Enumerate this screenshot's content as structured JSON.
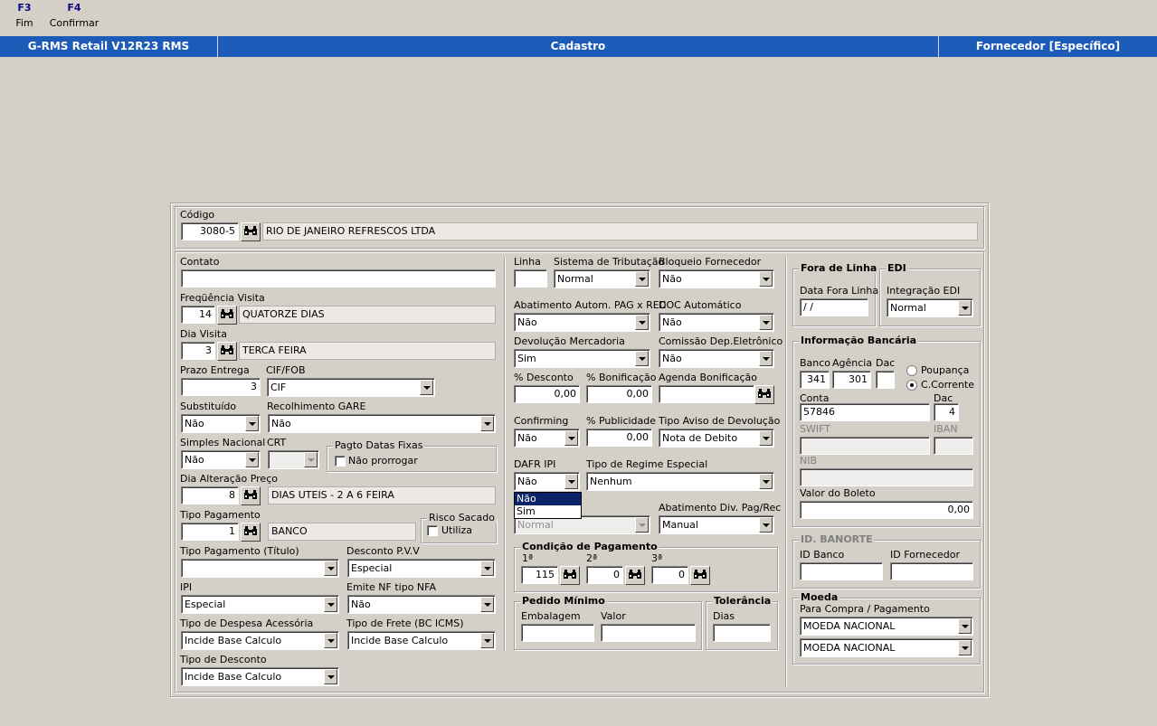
{
  "fkeys": [
    {
      "key": "F3",
      "label": "Fim"
    },
    {
      "key": "F4",
      "label": "Confirmar"
    }
  ],
  "titlebar": {
    "app": "G-RMS Retail V12R23 RMS",
    "module": "Cadastro",
    "screen": "Fornecedor [Específico]",
    "color": "#1c5bb7"
  },
  "header": {
    "codigo_label": "Código",
    "codigo_value": "3080-5",
    "razao_social": "RIO DE JANEIRO REFRESCOS LTDA"
  },
  "left": {
    "contato_label": "Contato",
    "contato_value": "",
    "freq_label": "Freqüência Visita",
    "freq_value": "14",
    "freq_desc": "QUATORZE DIAS",
    "dia_visita_label": "Dia Visita",
    "dia_visita_value": "3",
    "dia_visita_desc": "TERCA FEIRA",
    "prazo_label": "Prazo Entrega",
    "prazo_value": "3",
    "ciffob_label": "CIF/FOB",
    "ciffob_value": "CIF",
    "substituido_label": "Substituído",
    "substituido_value": "Não",
    "gare_label": "Recolhimento GARE",
    "gare_value": "Não",
    "simples_label": "Simples Nacional",
    "simples_value": "Não",
    "crt_label": "CRT",
    "crt_value": "",
    "pagto_datas_label": "Pagto Datas Fixas",
    "nao_prorrogar_label": "Não prorrogar",
    "dia_alt_label": "Dia Alteração Preço",
    "dia_alt_value": "8",
    "dia_alt_desc": "DIAS UTEIS -  2  A  6 FEIRA",
    "tipo_pag_label": "Tipo Pagamento",
    "tipo_pag_value": "1",
    "tipo_pag_desc": "BANCO",
    "risco_label": "Risco Sacado",
    "utiliza_label": "Utiliza",
    "tipo_pag_tit_label": "Tipo Pagamento (Título)",
    "tipo_pag_tit_value": "",
    "desc_pvv_label": "Desconto P.V.V",
    "desc_pvv_value": "Especial",
    "ipi_label": "IPI",
    "ipi_value": "Especial",
    "emite_nf_label": "Emite NF tipo NFA",
    "emite_nf_value": "Não",
    "tipo_desp_label": "Tipo de Despesa Acessória",
    "tipo_desp_value": "Incide Base Calculo",
    "tipo_frete_label": "Tipo de Frete (BC ICMS)",
    "tipo_frete_value": "Incide Base Calculo",
    "tipo_desc_label": "Tipo de Desconto",
    "tipo_desc_value": "Incide Base Calculo"
  },
  "middle": {
    "linha_label": "Linha",
    "linha_value": "",
    "sist_trib_label": "Sistema de Tributação",
    "sist_trib_value": "Normal",
    "bloqueio_label": "Bloqueio Fornecedor",
    "bloqueio_value": "Não",
    "abat_label": "Abatimento Autom. PAG x REC",
    "abat_value": "Não",
    "doc_label": "DOC Automático",
    "doc_value": "Não",
    "devol_label": "Devolução Mercadoria",
    "devol_value": "Sim",
    "comissao_label": "Comissão Dep.Eletrônico",
    "comissao_value": "Não",
    "pdesc_label": "% Desconto",
    "pdesc_value": "0,00",
    "pbonif_label": "% Bonificação",
    "pbonif_value": "0,00",
    "agenda_label": "Agenda Bonificação",
    "agenda_value": "",
    "confirming_label": "Confirming",
    "confirming_value": "Não",
    "ppub_label": "% Publicidade",
    "ppub_value": "0,00",
    "tipo_aviso_label": "Tipo Aviso de Devolução",
    "tipo_aviso_value": "Nota de Debito",
    "dafr_label": "DAFR IPI",
    "dafr_value": "Não",
    "dafr_options": [
      "Não",
      "Sim"
    ],
    "regime_label": "Tipo de Regime Especial",
    "regime_value": "Nenhum",
    "hidden_sel_value": "Normal",
    "abat_div_label": "Abatimento Div. Pag/Rec",
    "abat_div_value": "Manual",
    "cond_pag_label": "Condição de Pagamento",
    "cond1_label": "1ª",
    "cond1_value": "115",
    "cond2_label": "2ª",
    "cond2_value": "0",
    "cond3_label": "3ª",
    "cond3_value": "0",
    "pedido_min_label": "Pedido Mínimo",
    "embalagem_label": "Embalagem",
    "embalagem_value": "",
    "valor_label": "Valor",
    "valor_value": "",
    "tolerancia_label": "Tolerância",
    "dias_label": "Dias",
    "dias_value": ""
  },
  "right": {
    "fora_linha_label": "Fora de Linha",
    "data_fora_label": "Data Fora Linha",
    "data_fora_value": " /  /",
    "edi_label": "EDI",
    "integ_edi_label": "Integração EDI",
    "integ_edi_value": "Normal",
    "info_banc_label": "Informação Bancária",
    "banco_label": "Banco",
    "banco_value": "341",
    "agencia_label": "Agência",
    "agencia_value": "301",
    "dac_label": "Dac",
    "dac_value": "",
    "poupanca_label": "Poupança",
    "ccorrente_label": "C.Corrente",
    "conta_label": "Conta",
    "conta_value": "57846",
    "dac2_label": "Dac",
    "dac2_value": "4",
    "swift_label": "SWIFT",
    "swift_value": "",
    "iban_label": "IBAN",
    "iban_value": "",
    "nib_label": "NIB",
    "nib_value": "",
    "valor_boleto_label": "Valor do Boleto",
    "valor_boleto_value": "0,00",
    "banorte_label": "ID. BANORTE",
    "id_banco_label": "ID Banco",
    "id_banco_value": "",
    "id_forn_label": "ID Fornecedor",
    "id_forn_value": "",
    "moeda_label": "Moeda",
    "para_compra_label": "Para Compra / Pagamento",
    "moeda1_value": "MOEDA NACIONAL",
    "moeda2_value": "MOEDA NACIONAL"
  }
}
